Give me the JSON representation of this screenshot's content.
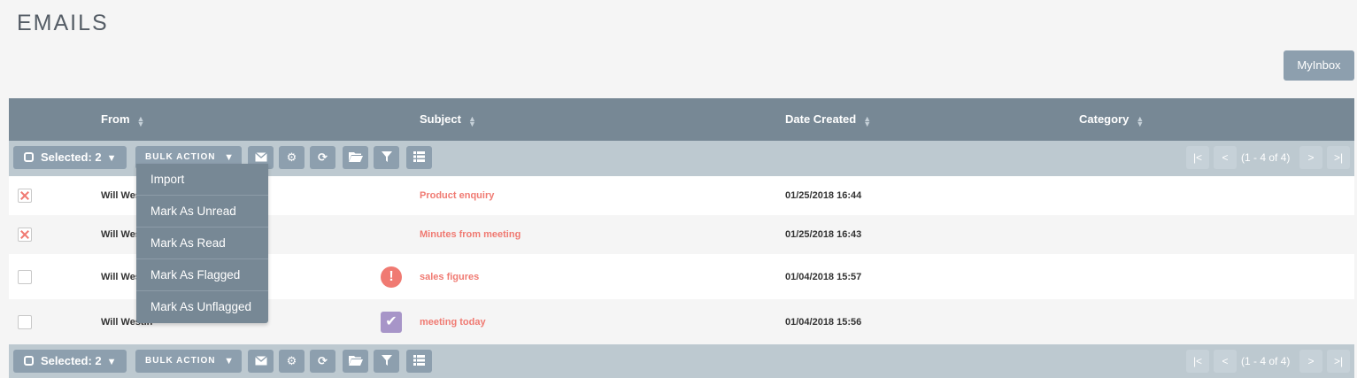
{
  "page": {
    "title": "EMAILS",
    "myinbox_label": "MyInbox"
  },
  "columns": {
    "from": "From",
    "subject": "Subject",
    "date_created": "Date Created",
    "category": "Category"
  },
  "toolbar": {
    "selected_label": "Selected: 2",
    "bulk_action_label": "BULK ACTION",
    "pagination": "(1 - 4 of 4)",
    "first": "|<",
    "prev": "<",
    "next": ">",
    "last": ">|"
  },
  "bulk_menu": [
    "Import",
    "Mark As Unread",
    "Mark As Read",
    "Mark As Flagged",
    "Mark As Unflagged"
  ],
  "rows": [
    {
      "checked": true,
      "from": "Will Westin",
      "subject": "Product enquiry",
      "date": "01/25/2018 16:44",
      "status_icon": ""
    },
    {
      "checked": true,
      "from": "Will Westin",
      "subject": "Minutes from meeting",
      "date": "01/25/2018 16:43",
      "status_icon": ""
    },
    {
      "checked": false,
      "from": "Will Westin",
      "subject": "sales figures",
      "date": "01/04/2018 15:57",
      "status_icon": "flagged-icon"
    },
    {
      "checked": false,
      "from": "Will Westin",
      "subject": "meeting today",
      "date": "01/04/2018 15:56",
      "status_icon": "checked-icon"
    }
  ],
  "colors": {
    "header": "#778895",
    "toolbar": "#bdc9d0",
    "button": "#8d9fae",
    "accent": "#f07a72",
    "check_purple": "#a795c8"
  }
}
